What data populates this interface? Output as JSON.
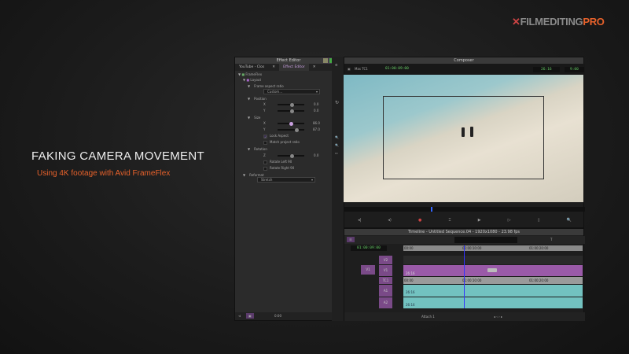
{
  "logo": {
    "prefix": "✕",
    "main": "FILMEDITING",
    "pro": "PRO"
  },
  "headline": {
    "title": "FAKING CAMERA MOVEMENT",
    "subtitle": "Using 4K footage with Avid FrameFlex"
  },
  "effect_editor": {
    "title": "Effect Editor",
    "tabs": [
      {
        "label": "YouTube - Clos"
      },
      {
        "label": "Effect Editor"
      }
    ],
    "effect": "FrameFlex",
    "group": "Layout",
    "frame_aspect_label": "Frame aspect ratio",
    "frame_aspect_value": "Custom...",
    "position_label": "Position",
    "x_label": "X",
    "y_label": "Y",
    "pos_x": "0.0",
    "pos_y": "0.0",
    "size_label": "Size",
    "size_x": "86.0",
    "size_y": "87.0",
    "lock_aspect": "Lock Aspect",
    "match_aspect": "Match project ratio",
    "rotation_label": "Rotation",
    "z_label": "Z",
    "rot_z": "0.0",
    "rotate_left": "Rotate Left 90",
    "rotate_right": "Rotate Right 90",
    "reformat_label": "Reformat",
    "reformat_value": "Stretch",
    "footer_time": "0:00"
  },
  "composer": {
    "title": "Composer",
    "source_label": "Mas TC1",
    "timecode": "01:00:09:00",
    "duration": "26:16",
    "counter": "9:00"
  },
  "timeline": {
    "title": "Timeline - Untitled Sequence.04 - 1920x1080 - 23.98 fps",
    "timecode": "01:00:09:00",
    "ruler": [
      "00:00",
      "01:00:10:00",
      "01:00:20:00"
    ],
    "tracks": [
      {
        "label": "V2"
      },
      {
        "label": "V1"
      },
      {
        "label": "TC1"
      },
      {
        "label": "A1"
      },
      {
        "label": "A2"
      }
    ],
    "source_track": "V1",
    "clip_duration": "26:16",
    "footer_label": "Attach 1"
  },
  "colors": {
    "accent": "#e8622b",
    "video_track": "#9a5aa8",
    "audio_track": "#72c2c0"
  }
}
